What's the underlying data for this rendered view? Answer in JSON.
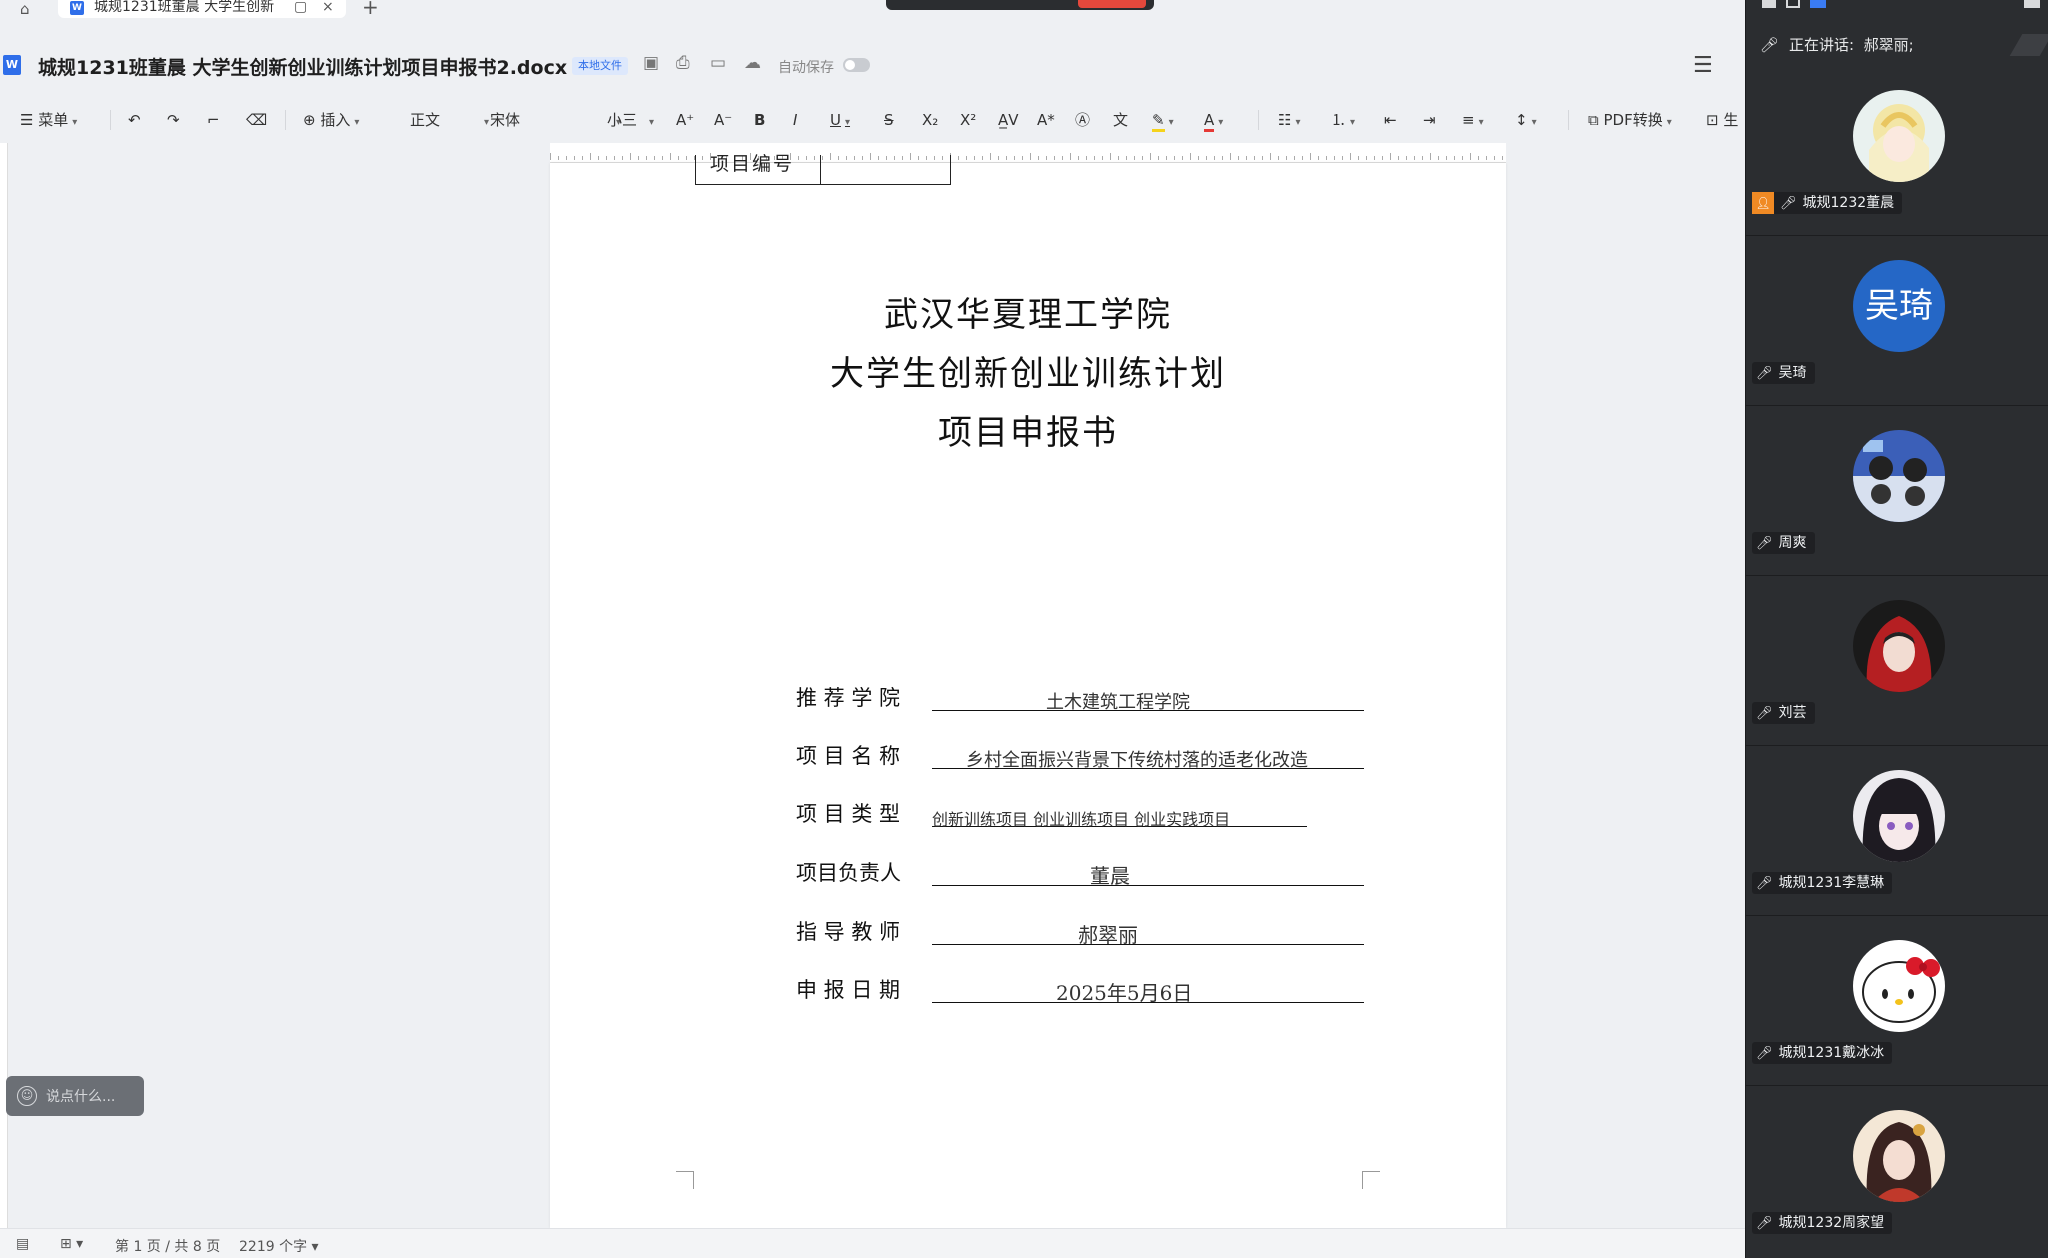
{
  "tab": {
    "title": "城规1231班董晨 大学生创新",
    "close": "×",
    "new_tab": "+"
  },
  "titlebar": {
    "doc_title": "城规1231班董晨  大学生创新创业训练计划项目申报书2.docx",
    "badge": "本地文件",
    "autosave_label": "自动保存"
  },
  "toolbar": {
    "menu": "菜单",
    "insert": "插入",
    "style": "正文",
    "font": "宋体",
    "size": "小三",
    "pdf": "PDF转换",
    "more": "生"
  },
  "document": {
    "project_no_label": "项目编号",
    "heading_lines": [
      "武汉华夏理工学院",
      "大学生创新创业训练计划",
      "项目申报书"
    ],
    "fields": [
      {
        "label": "推 荐 学 院",
        "value": "土木建筑工程学院"
      },
      {
        "label": "项 目 名 称",
        "value": "乡村全面振兴背景下传统村落的适老化改造"
      },
      {
        "label": "项 目 类 型",
        "value": "创新训练项目    创业训练项目   创业实践项目"
      },
      {
        "label": "项目负责人",
        "value": "董晨"
      },
      {
        "label": "指 导 教 师",
        "value": "郝翠丽"
      },
      {
        "label": "申 报 日 期",
        "value": "2025年5月6日"
      }
    ]
  },
  "chat": {
    "placeholder": "说点什么..."
  },
  "statusbar": {
    "page_info": "第 1 页 / 共 8 页",
    "word_count": "2219 个字"
  },
  "meeting": {
    "speaking_label": "正在讲话:",
    "speaking_name": "郝翠丽;",
    "participants": [
      {
        "name": "城规1232董晨",
        "host": true
      },
      {
        "name": "吴琦",
        "avatar_text": "吴琦"
      },
      {
        "name": "周爽"
      },
      {
        "name": "刘芸"
      },
      {
        "name": "城规1231李慧琳"
      },
      {
        "name": "城规1231戴冰冰"
      },
      {
        "name": "城规1232周家望"
      }
    ]
  },
  "colors": {
    "accent": "#2f6ee9",
    "panel_bg": "#2b2d30",
    "avatar_blue": "#2567c6",
    "host_orange": "#f08a24"
  }
}
